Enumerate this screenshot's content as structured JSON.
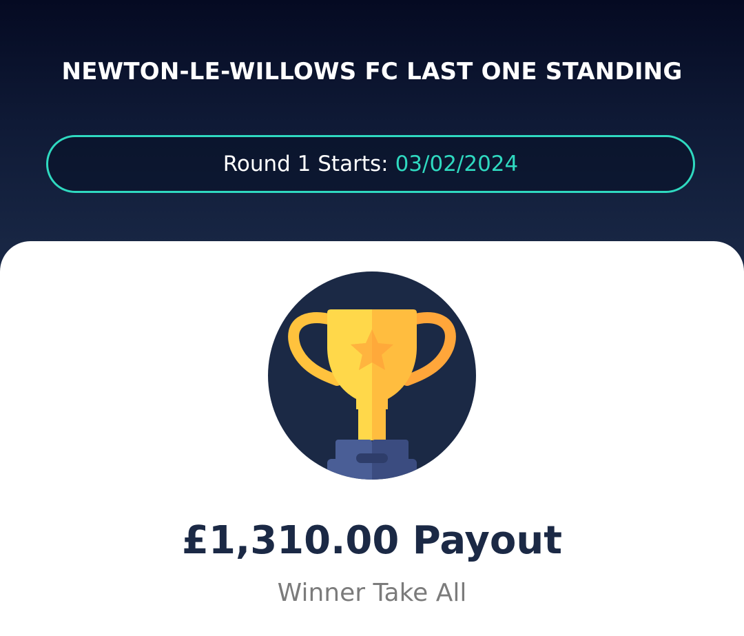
{
  "header": {
    "title": "NEWTON-LE-WILLOWS FC LAST ONE STANDING",
    "round_label": "Round 1 Starts:",
    "round_date": "03/02/2024"
  },
  "prize": {
    "icon": "trophy-icon",
    "payout": "£1,310.00 Payout",
    "subtitle": "Winner Take All"
  },
  "colors": {
    "header_dark": "#050a22",
    "accent": "#2fd9c0",
    "navy": "#1b2945",
    "trophy_gold": "#ffd84a",
    "subtitle_gray": "#7b7b7b"
  }
}
